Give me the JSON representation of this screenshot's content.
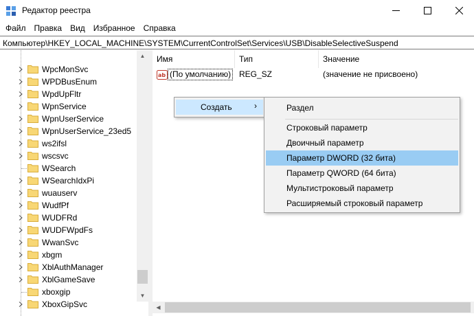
{
  "window": {
    "title": "Редактор реестра",
    "icon": "registry-icon",
    "controls": [
      "minimize-icon",
      "maximize-icon",
      "close-icon"
    ]
  },
  "menubar": {
    "items": [
      "Файл",
      "Правка",
      "Вид",
      "Избранное",
      "Справка"
    ]
  },
  "address": {
    "path": "Компьютер\\HKEY_LOCAL_MACHINE\\SYSTEM\\CurrentControlSet\\Services\\USB\\DisableSelectiveSuspend"
  },
  "tree": {
    "items": [
      {
        "label": "WpcMonSvc",
        "expandable": true
      },
      {
        "label": "WPDBusEnum",
        "expandable": true
      },
      {
        "label": "WpdUpFltr",
        "expandable": true
      },
      {
        "label": "WpnService",
        "expandable": true
      },
      {
        "label": "WpnUserService",
        "expandable": true
      },
      {
        "label": "WpnUserService_23ed5",
        "expandable": true
      },
      {
        "label": "ws2ifsl",
        "expandable": true
      },
      {
        "label": "wscsvc",
        "expandable": true
      },
      {
        "label": "WSearch",
        "expandable": false
      },
      {
        "label": "WSearchIdxPi",
        "expandable": true
      },
      {
        "label": "wuauserv",
        "expandable": true
      },
      {
        "label": "WudfPf",
        "expandable": true
      },
      {
        "label": "WUDFRd",
        "expandable": true
      },
      {
        "label": "WUDFWpdFs",
        "expandable": true
      },
      {
        "label": "WwanSvc",
        "expandable": true
      },
      {
        "label": "xbgm",
        "expandable": true
      },
      {
        "label": "XblAuthManager",
        "expandable": true
      },
      {
        "label": "XblGameSave",
        "expandable": true
      },
      {
        "label": "xboxgip",
        "expandable": false
      },
      {
        "label": "XboxGipSvc",
        "expandable": true
      }
    ]
  },
  "list": {
    "columns": {
      "name": "Имя",
      "type": "Тип",
      "value": "Значение"
    },
    "rows": [
      {
        "name": "(По умолчанию)",
        "type": "REG_SZ",
        "value": "(значение не присвоено)",
        "icon": "ab-string-icon"
      }
    ]
  },
  "context_menu": {
    "item": "Создать",
    "submenu": {
      "items": [
        {
          "label": "Раздел"
        },
        {
          "label": "Строковый параметр"
        },
        {
          "label": "Двоичный параметр"
        },
        {
          "label": "Параметр DWORD (32 бита)",
          "highlighted": true
        },
        {
          "label": "Параметр QWORD (64 бита)"
        },
        {
          "label": "Мультистроковый параметр"
        },
        {
          "label": "Расширяемый строковый параметр"
        }
      ]
    }
  },
  "colors": {
    "folder": "#f8d775",
    "menu_hover": "#cce8ff",
    "submenu_highlight": "#99ccf3",
    "menu_bg": "#f2f2f2"
  }
}
